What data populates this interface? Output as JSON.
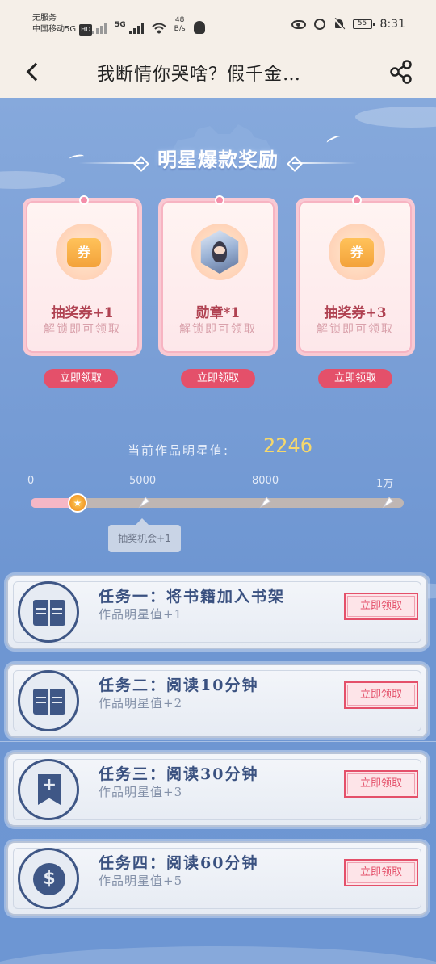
{
  "status_bar": {
    "service": "无服务",
    "carrier": "中国移动5G",
    "hd_badge": "HD",
    "net_5g": "5G",
    "speed_value": "48",
    "speed_unit": "B/s",
    "battery": "55",
    "time": "8:31"
  },
  "nav": {
    "title": "我断情你哭啥？假千金…"
  },
  "section": {
    "title": "明星爆款奖励"
  },
  "rewards": [
    {
      "name": "抽奖券+1",
      "hint": "解锁即可领取",
      "button": "立即领取",
      "icon": "ticket-icon",
      "icon_text": "券"
    },
    {
      "name": "勋章*1",
      "hint": "解锁即可领取",
      "button": "立即领取",
      "icon": "medal-icon"
    },
    {
      "name": "抽奖券+3",
      "hint": "解锁即可领取",
      "button": "立即领取",
      "icon": "ticket-icon",
      "icon_text": "券"
    }
  ],
  "star": {
    "label": "当前作品明星值:",
    "value": "2246"
  },
  "progress": {
    "ticks": [
      "0",
      "5000",
      "8000",
      "1万"
    ],
    "value": 2246,
    "max": 10000,
    "tooltip": "抽奖机会+1"
  },
  "tasks": [
    {
      "title": "任务一：将书籍加入书架",
      "reward": "作品明星值+1",
      "button": "立即领取",
      "icon": "book-icon"
    },
    {
      "title": "任务二：阅读10分钟",
      "reward": "作品明星值+2",
      "button": "立即领取",
      "icon": "book-icon"
    },
    {
      "title": "任务三：阅读30分钟",
      "reward": "作品明星值+3",
      "button": "立即领取",
      "icon": "bookmark-plus-icon",
      "icon_text": "+"
    },
    {
      "title": "任务四：阅读60分钟",
      "reward": "作品明星值+5",
      "button": "立即领取",
      "icon": "coin-icon",
      "icon_text": "$"
    }
  ],
  "colors": {
    "accent": "#e4506a",
    "task_title": "#3a5180",
    "star_value": "#f6d86b",
    "background": "#6f9ad6"
  }
}
